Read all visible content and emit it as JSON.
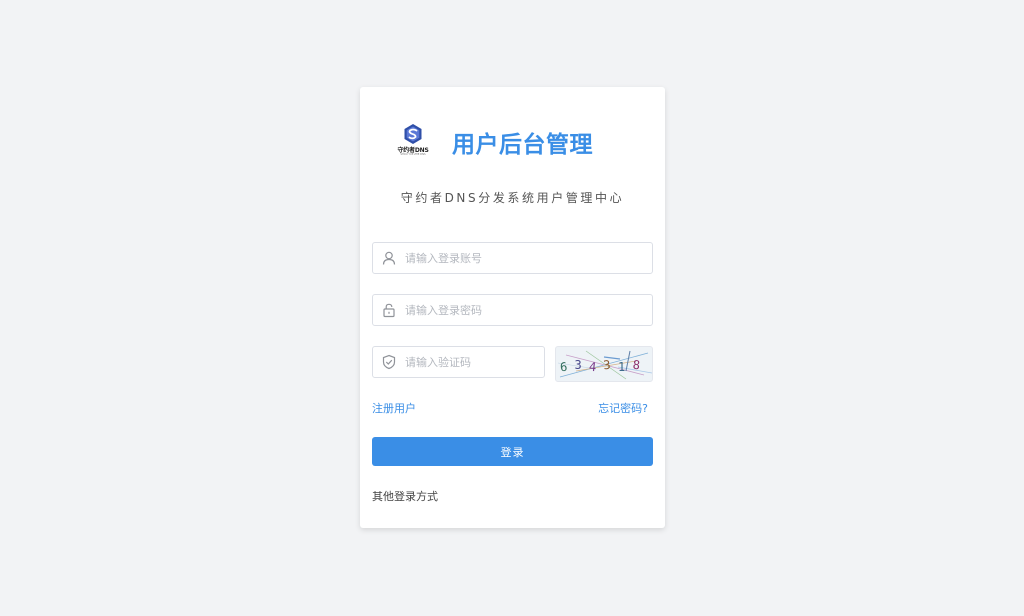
{
  "brand": {
    "logo_text": "守约者DNS",
    "logo_subtext": "SHOU YUE ZHE DNS",
    "title": "用户后台管理",
    "subtitle": "守约者DNS分发系统用户管理中心"
  },
  "form": {
    "username": {
      "value": "",
      "placeholder": "请输入登录账号",
      "icon": "user-icon"
    },
    "password": {
      "value": "",
      "placeholder": "请输入登录密码",
      "icon": "lock-icon"
    },
    "captcha": {
      "value": "",
      "placeholder": "请输入验证码",
      "icon": "shield-icon",
      "image_text": "634318"
    }
  },
  "links": {
    "register": "注册用户",
    "forgot": "忘记密码?"
  },
  "login_button": "登录",
  "other_login": "其他登录方式",
  "colors": {
    "accent": "#3a8ee6",
    "background": "#f2f3f5",
    "card": "#ffffff"
  }
}
